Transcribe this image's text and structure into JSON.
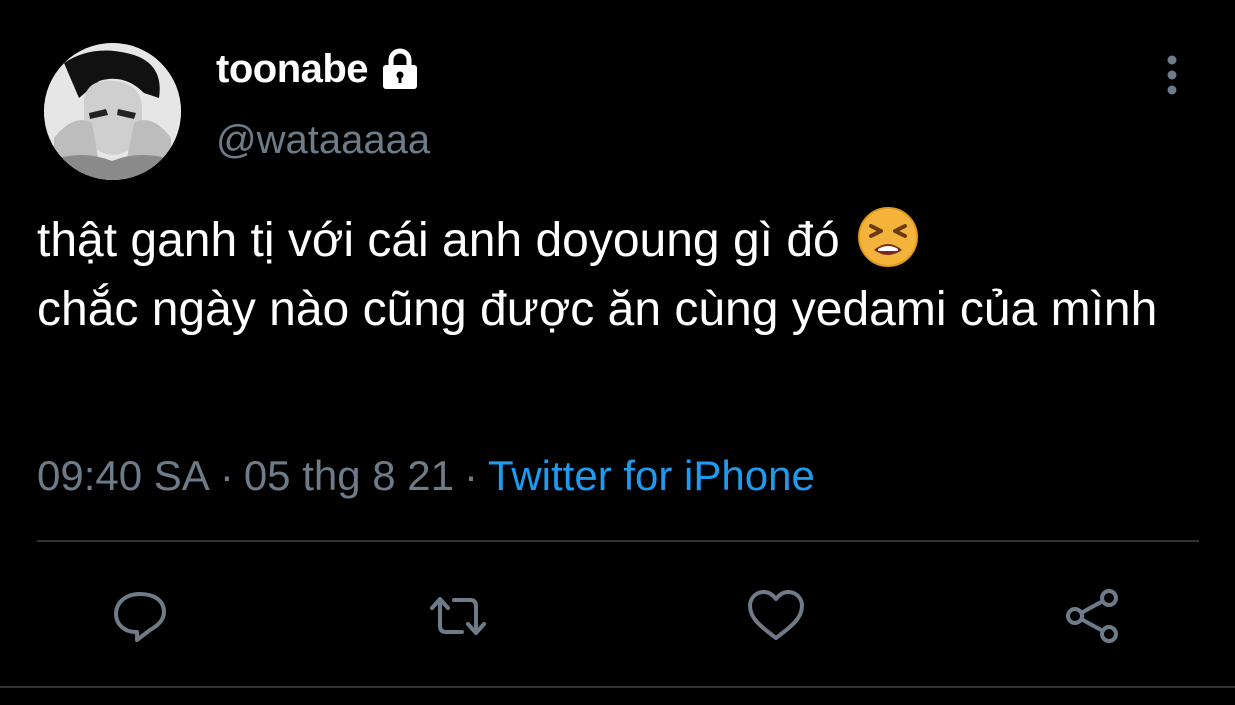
{
  "user": {
    "display_name": "toonabe",
    "handle": "@wataaaaa",
    "avatar_icon": "avatar-photo",
    "protected_icon": "lock-icon"
  },
  "tweet": {
    "text": "thật ganh tị với cái anh doyoung gì đó ",
    "text_rest": "chắc ngày nào cũng được ăn cùng yedami của mình",
    "emoji_icon": "tired-face-emoji"
  },
  "meta": {
    "time": "09:40 SA",
    "separator": "·",
    "date": "05 thg 8 21",
    "source": "Twitter for iPhone"
  },
  "actions": {
    "reply": "reply-icon",
    "retweet": "retweet-icon",
    "like": "like-icon",
    "share": "share-icon",
    "more": "more-options-icon"
  },
  "colors": {
    "background": "#000000",
    "primary_text": "#ffffff",
    "secondary_text": "#6e7b88",
    "link": "#1d9bf0",
    "divider": "#2f3336"
  }
}
